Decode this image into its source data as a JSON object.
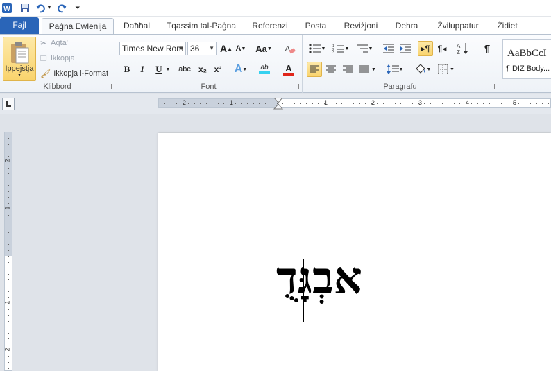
{
  "qat": {
    "app_icon": "word-icon",
    "items": [
      "save-icon",
      "undo-icon",
      "redo-icon",
      "customize-icon"
    ]
  },
  "tabs": [
    {
      "label": "Fajl"
    },
    {
      "label": "Paġna Ewlenija"
    },
    {
      "label": "Daħħal"
    },
    {
      "label": "Tqassim tal-Paġna"
    },
    {
      "label": "Referenzi"
    },
    {
      "label": "Posta"
    },
    {
      "label": "Reviżjoni"
    },
    {
      "label": "Dehra"
    },
    {
      "label": "Żviluppatur"
    },
    {
      "label": "Żidiet"
    }
  ],
  "ribbon": {
    "clipboard": {
      "label": "Klibbord",
      "paste": "Ippejstja",
      "cut": "Aqta'",
      "copy": "Ikkopja",
      "format_painter": "Ikkopja l-Format"
    },
    "font": {
      "label": "Font",
      "font_name": "Times New Rom",
      "font_size": "36",
      "grow": "A",
      "shrink": "A",
      "change_case": "Aa",
      "bold": "B",
      "italic": "I",
      "underline": "U",
      "strike": "abc",
      "subscript": "x₂",
      "superscript": "x²",
      "text_effects": "A",
      "highlight": "ab",
      "font_color": "A"
    },
    "paragraph": {
      "label": "Paragrafu"
    },
    "styles": {
      "preview": "AaBbCcI",
      "name": "¶ DIZ Body..."
    }
  },
  "ruler": {
    "numbers": [
      "2",
      "1",
      "1",
      "2",
      "3",
      "4",
      "5"
    ],
    "vertical_numbers": [
      "2",
      "1",
      "1",
      "2"
    ]
  },
  "document": {
    "text": "אבְגָּדֻ"
  },
  "colors": {
    "accent": "#2a65b8",
    "highlight": "#f9d36d"
  }
}
